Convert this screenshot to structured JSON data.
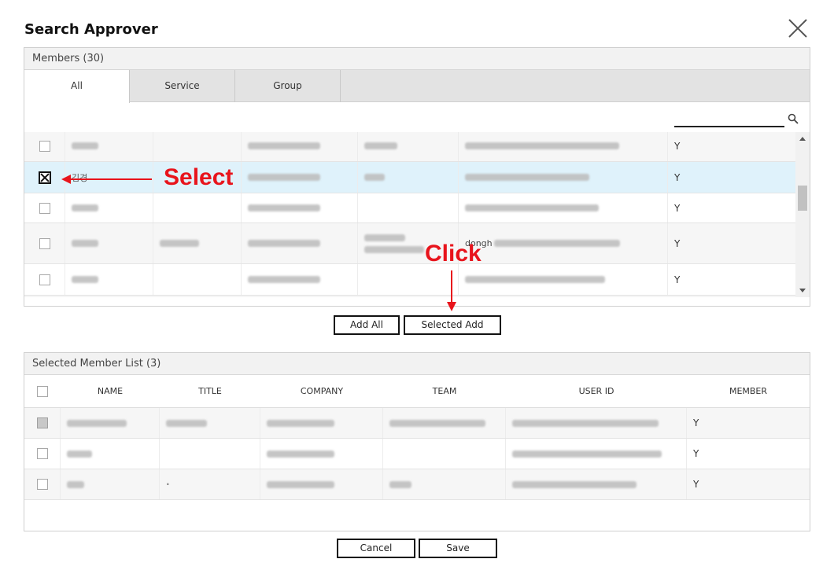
{
  "dialog": {
    "title": "Search Approver"
  },
  "members": {
    "header": "Members (30)",
    "tabs": [
      {
        "label": "All"
      },
      {
        "label": "Service"
      },
      {
        "label": "Group"
      }
    ],
    "search": {
      "value": "",
      "placeholder": ""
    },
    "rows": [
      {
        "checked": false,
        "member": "Y"
      },
      {
        "checked": true,
        "name_visible": "김경",
        "member": "Y"
      },
      {
        "checked": false,
        "member": "Y"
      },
      {
        "checked": false,
        "user_id_visible": "dongh",
        "member": "Y"
      },
      {
        "checked": false,
        "member": "Y"
      }
    ]
  },
  "actions": {
    "add_all": "Add All",
    "selected_add": "Selected Add"
  },
  "selected": {
    "header": "Selected Member List (3)",
    "columns": [
      "NAME",
      "TITLE",
      "COMPANY",
      "TEAM",
      "USER ID",
      "MEMBER"
    ],
    "rows": [
      {
        "checkbox": "gray",
        "member": "Y"
      },
      {
        "checkbox": "empty",
        "member": "Y"
      },
      {
        "checkbox": "empty",
        "title_visible": "·",
        "member": "Y"
      }
    ]
  },
  "footer": {
    "cancel": "Cancel",
    "save": "Save"
  },
  "annotations": {
    "select": "Select",
    "click": "Click",
    "color": "#e8141c"
  },
  "icons": {
    "close": "close-icon",
    "search": "search-icon"
  }
}
